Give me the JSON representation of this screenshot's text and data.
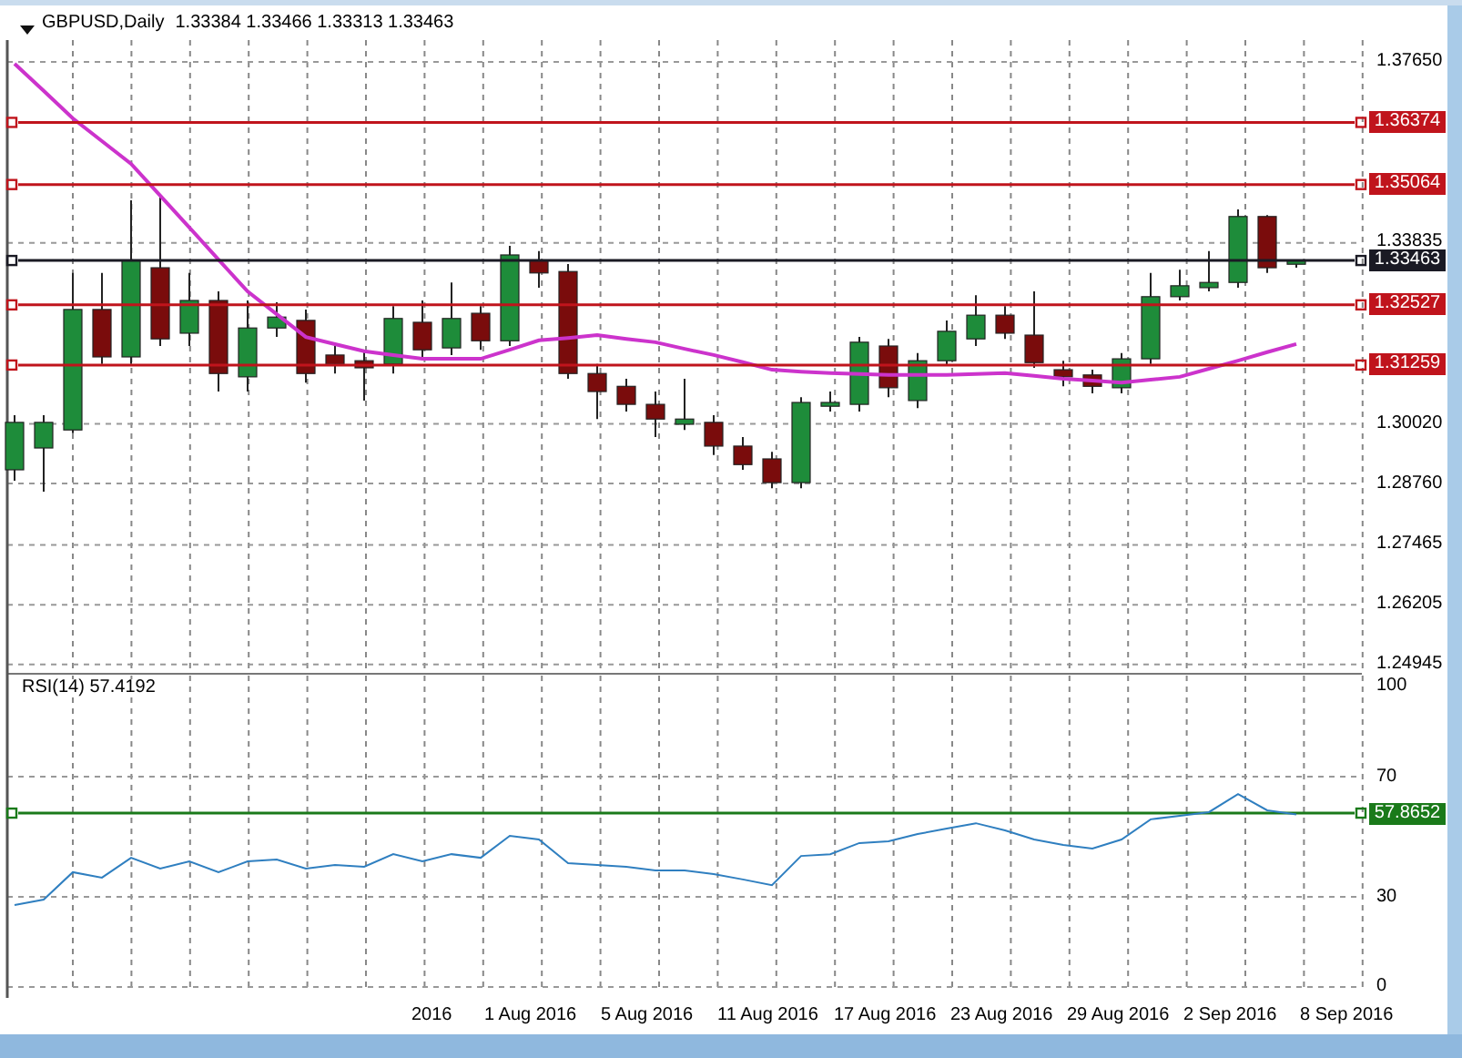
{
  "chart_header": {
    "symbol": "GBPUSD,Daily",
    "ohlc": "1.33384 1.33466 1.33313 1.33463"
  },
  "price_chart": {
    "chart_data": {
      "type": "candlestick",
      "grid": true,
      "ylim": [
        1.2475,
        1.3811
      ],
      "ohlc": [
        [
          1.2905,
          1.302,
          1.2882,
          1.3005
        ],
        [
          1.2951,
          1.302,
          1.2859,
          1.3005
        ],
        [
          1.2989,
          1.332,
          1.2982,
          1.3243
        ],
        [
          1.3243,
          1.332,
          1.3128,
          1.3143
        ],
        [
          1.3143,
          1.3473,
          1.3128,
          1.3346
        ],
        [
          1.3331,
          1.3481,
          1.3166,
          1.3181
        ],
        [
          1.3193,
          1.332,
          1.3166,
          1.3262
        ],
        [
          1.3262,
          1.3281,
          1.307,
          1.3108
        ],
        [
          1.3101,
          1.3262,
          1.307,
          1.3204
        ],
        [
          1.3204,
          1.3258,
          1.3185,
          1.3227
        ],
        [
          1.322,
          1.3243,
          1.3089,
          1.3108
        ],
        [
          1.3147,
          1.3166,
          1.3108,
          1.3128
        ],
        [
          1.3135,
          1.3158,
          1.3051,
          1.312
        ],
        [
          1.3128,
          1.325,
          1.3108,
          1.3224
        ],
        [
          1.3216,
          1.3262,
          1.3143,
          1.3158
        ],
        [
          1.3162,
          1.33,
          1.3147,
          1.3224
        ],
        [
          1.3235,
          1.325,
          1.3158,
          1.3177
        ],
        [
          1.3177,
          1.3377,
          1.3166,
          1.3358
        ],
        [
          1.3346,
          1.3366,
          1.3289,
          1.332
        ],
        [
          1.3323,
          1.3339,
          1.3097,
          1.3108
        ],
        [
          1.3108,
          1.3128,
          1.3012,
          1.307
        ],
        [
          1.3081,
          1.3097,
          1.3028,
          1.3043
        ],
        [
          1.3043,
          1.307,
          1.2974,
          1.3012
        ],
        [
          1.3001,
          1.3097,
          1.2989,
          1.3012
        ],
        [
          1.3005,
          1.302,
          1.2936,
          1.2955
        ],
        [
          1.2955,
          1.2974,
          1.2905,
          1.2916
        ],
        [
          1.2928,
          1.2943,
          1.2866,
          1.2878
        ],
        [
          1.2878,
          1.3058,
          1.2866,
          1.3047
        ],
        [
          1.3039,
          1.307,
          1.3028,
          1.3047
        ],
        [
          1.3043,
          1.3185,
          1.3028,
          1.3174
        ],
        [
          1.3166,
          1.3181,
          1.3058,
          1.3078
        ],
        [
          1.3051,
          1.3151,
          1.3035,
          1.3135
        ],
        [
          1.3135,
          1.322,
          1.3124,
          1.3197
        ],
        [
          1.3181,
          1.3273,
          1.3166,
          1.3231
        ],
        [
          1.3231,
          1.325,
          1.3181,
          1.3193
        ],
        [
          1.3189,
          1.3281,
          1.312,
          1.3131
        ],
        [
          1.3116,
          1.3135,
          1.3081,
          1.3101
        ],
        [
          1.3105,
          1.3116,
          1.3066,
          1.3081
        ],
        [
          1.3078,
          1.3151,
          1.3066,
          1.3139
        ],
        [
          1.3139,
          1.332,
          1.3128,
          1.327
        ],
        [
          1.327,
          1.3327,
          1.3262,
          1.3293
        ],
        [
          1.3289,
          1.3366,
          1.3281,
          1.33
        ],
        [
          1.33,
          1.3454,
          1.3289,
          1.3439
        ],
        [
          1.3439,
          1.3442,
          1.332,
          1.3331
        ],
        [
          1.33384,
          1.33466,
          1.33313,
          1.33463
        ]
      ],
      "series": [
        {
          "type": "line",
          "color": "#cc33cc",
          "values": [
            1.3761,
            1.3704,
            1.3646,
            1.3598,
            1.355,
            1.3483,
            1.3416,
            1.3348,
            1.3281,
            1.3233,
            1.3185,
            1.317,
            1.3155,
            1.3147,
            1.3139,
            1.3139,
            1.3139,
            1.3158,
            1.3178,
            1.3183,
            1.3189,
            1.3181,
            1.3174,
            1.316,
            1.3147,
            1.3132,
            1.3116,
            1.3112,
            1.3109,
            1.3107,
            1.3105,
            1.3105,
            1.3105,
            1.3107,
            1.3109,
            1.3103,
            1.3097,
            1.3093,
            1.3089,
            1.3095,
            1.3101,
            1.3118,
            1.3135,
            1.3153,
            1.317
          ]
        }
      ],
      "yticks": [
        {
          "value": 1.3765,
          "label": "1.37650"
        },
        {
          "value": 1.33835,
          "label": "1.33835"
        },
        {
          "value": 1.3002,
          "label": "1.30020"
        },
        {
          "value": 1.2876,
          "label": "1.28760"
        },
        {
          "value": 1.27465,
          "label": "1.27465"
        },
        {
          "value": 1.26205,
          "label": "1.26205"
        },
        {
          "value": 1.24945,
          "label": "1.24945"
        }
      ],
      "ref_lines": [
        {
          "axis": "y",
          "value": 1.36374,
          "label": "1.36374",
          "color": "#c0141c"
        },
        {
          "axis": "y",
          "value": 1.35064,
          "label": "1.35064",
          "color": "#c0141c"
        },
        {
          "axis": "y",
          "value": 1.33463,
          "label": "1.33463",
          "color": "#1a1a24"
        },
        {
          "axis": "y",
          "value": 1.32527,
          "label": "1.32527",
          "color": "#c0141c"
        },
        {
          "axis": "y",
          "value": 1.31259,
          "label": "1.31259",
          "color": "#c0141c"
        }
      ]
    }
  },
  "rsi": {
    "title": "RSI(14) 57.4192",
    "chart_data": {
      "type": "line",
      "grid": true,
      "ylim": [
        0,
        100
      ],
      "series": [
        {
          "color": "#2f7fc0",
          "values": [
            27.3,
            29.1,
            38.2,
            36.4,
            43.0,
            39.4,
            41.8,
            38.2,
            41.8,
            42.4,
            39.4,
            40.6,
            40.0,
            44.2,
            41.8,
            44.2,
            43.0,
            50.3,
            49.1,
            41.2,
            40.6,
            40.0,
            38.8,
            38.8,
            37.6,
            35.8,
            33.9,
            43.6,
            44.2,
            47.9,
            48.5,
            50.9,
            52.7,
            54.5,
            52.1,
            49.1,
            47.3,
            46.1,
            49.1,
            55.8,
            57.0,
            58.2,
            64.2,
            58.8,
            57.4
          ]
        }
      ],
      "yticks": [
        {
          "value": 100,
          "label": "100"
        },
        {
          "value": 70,
          "label": "70"
        },
        {
          "value": 30,
          "label": "30"
        },
        {
          "value": 0,
          "label": "0"
        }
      ],
      "ref_lines": [
        {
          "axis": "y",
          "value": 57.8652,
          "label": "57.8652",
          "color": "#1a7a1a"
        }
      ]
    }
  },
  "time_axis": [
    "2016",
    "1 Aug 2016",
    "5 Aug 2016",
    "11 Aug 2016",
    "17 Aug 2016",
    "23 Aug 2016",
    "29 Aug 2016",
    "2 Sep 2016",
    "8 Sep 2016"
  ]
}
